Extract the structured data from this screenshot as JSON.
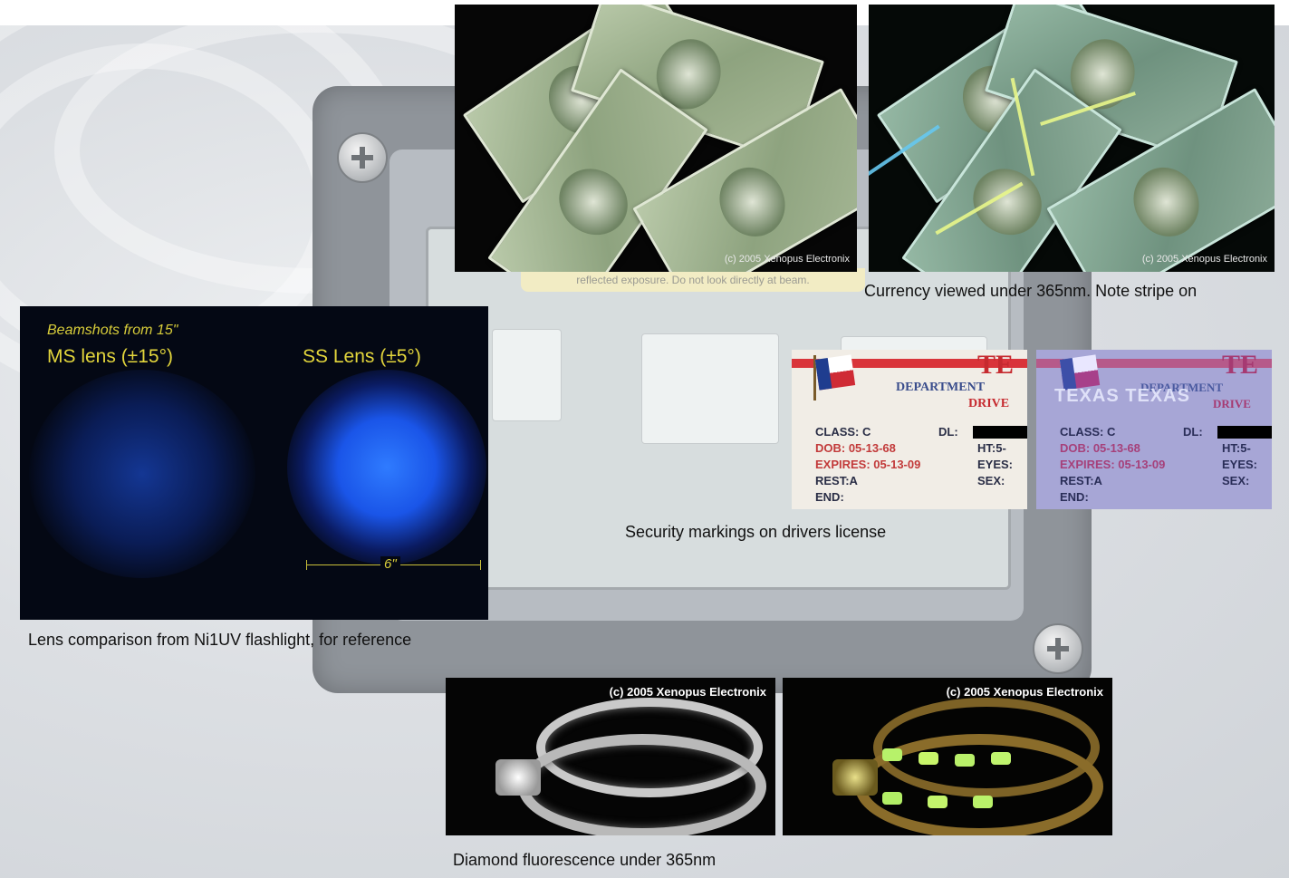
{
  "background": {
    "warning_label": "reflected exposure. Do not look directly at beam."
  },
  "currency": {
    "normal_watermark": "(c) 2005 Xenopus Electronix",
    "uv_watermark": "(c) 2005 Xenopus Electronix",
    "caption": "Currency viewed under 365nm. Note stripe on"
  },
  "beamshot": {
    "heading": "Beamshots from 15\"",
    "left_label": "MS lens (±15°)",
    "right_label": "SS Lens (±5°)",
    "scale_label": "6\"",
    "caption": "Lens comparison from Ni1UV flashlight, for reference"
  },
  "license": {
    "state": "TE",
    "dept": "DEPARTMENT",
    "dept_uv": "DEPARTMENT",
    "driver": "DRIVE",
    "driver_uv": "DRIVE",
    "uv_texas": "TEXAS TEXAS",
    "class_label": "CLASS: C",
    "dl_label": "DL:",
    "dob_label": "DOB: 05-13-68",
    "ht_label": "HT:5-",
    "expires_label": "EXPIRES: 05-13-09",
    "eyes_label": "EYES:",
    "rest_label": "REST:A",
    "sex_label": "SEX:",
    "end_label": "END:",
    "caption": "Security markings on drivers license"
  },
  "rings": {
    "normal_watermark": "(c) 2005 Xenopus Electronix",
    "uv_watermark": "(c) 2005 Xenopus Electronix",
    "caption": "Diamond fluorescence under 365nm"
  }
}
